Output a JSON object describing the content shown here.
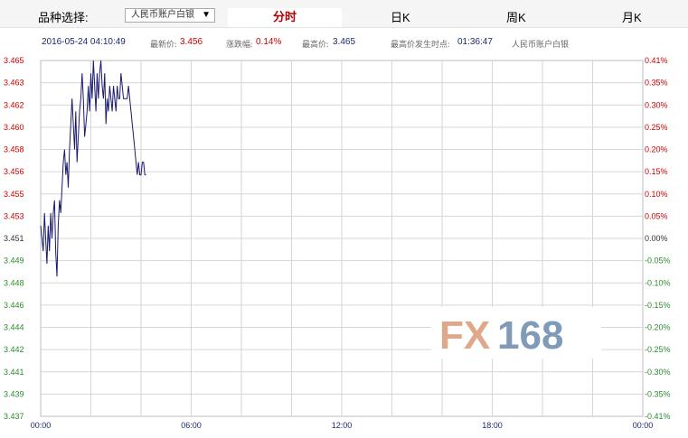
{
  "header": {
    "selector_label": "品种选择:",
    "selector_value": "人民币账户白银",
    "selector_arrow": "▼",
    "tabs": [
      {
        "label": "分时",
        "active": true
      },
      {
        "label": "日K",
        "active": false
      },
      {
        "label": "周K",
        "active": false
      },
      {
        "label": "月K",
        "active": false
      }
    ]
  },
  "info_bar": {
    "datetime": "2016-05-24 04:10:49",
    "latest_label": "最新价:",
    "latest_value": "3.456",
    "change_label": "涨跌幅:",
    "change_value": "0.14%",
    "high_label": "最高价:",
    "high_value": "3.465",
    "high_time_label": "最高价发生时点:",
    "high_time_value": "01:36:47",
    "product_name": "人民币账户白银"
  },
  "watermark": {
    "prefix": "FX",
    "suffix": "168"
  },
  "colors": {
    "line": "#1a1a6e",
    "up": "#cc0000",
    "down": "#2e8b2e",
    "neutral": "#333333",
    "watermark_fx": "#e0a88a",
    "watermark_num": "#7f9bb8"
  },
  "chart_data": {
    "type": "line",
    "x_ticks": [
      "00:00",
      "06:00",
      "12:00",
      "18:00",
      "00:00"
    ],
    "x_range_hours": [
      0,
      24
    ],
    "ylim": [
      3.437,
      3.465
    ],
    "y_ticks_left": [
      "3.465",
      "3.463",
      "3.462",
      "3.460",
      "3.458",
      "3.456",
      "3.455",
      "3.453",
      "3.451",
      "3.449",
      "3.448",
      "3.446",
      "3.444",
      "3.442",
      "3.441",
      "3.439",
      "3.437"
    ],
    "y_ticks_right": [
      "0.41%",
      "0.35%",
      "0.30%",
      "0.25%",
      "0.20%",
      "0.15%",
      "0.10%",
      "0.05%",
      "0.00%",
      "-0.05%",
      "-0.10%",
      "-0.15%",
      "-0.20%",
      "-0.25%",
      "-0.30%",
      "-0.35%",
      "-0.41%"
    ],
    "grid": true,
    "series": [
      {
        "hours": [
          0.0,
          0.05,
          0.1,
          0.15,
          0.2,
          0.25,
          0.3,
          0.35,
          0.4,
          0.45,
          0.5,
          0.55,
          0.6,
          0.65,
          0.7,
          0.75,
          0.8,
          0.85,
          0.9,
          0.95,
          1.0,
          1.05,
          1.1,
          1.15,
          1.2,
          1.25,
          1.3,
          1.35,
          1.4,
          1.45,
          1.5,
          1.55,
          1.6,
          1.65,
          1.7,
          1.75,
          1.8,
          1.85,
          1.9,
          1.95,
          2.0,
          2.05,
          2.1,
          2.15,
          2.2,
          2.25,
          2.3,
          2.35,
          2.4,
          2.45,
          2.5,
          2.55,
          2.6,
          2.65,
          2.7,
          2.75,
          2.8,
          2.85,
          2.9,
          2.95,
          3.0,
          3.05,
          3.1,
          3.15,
          3.2,
          3.25,
          3.3,
          3.35,
          3.4,
          3.45,
          3.5,
          3.55,
          3.6,
          3.65,
          3.7,
          3.75,
          3.8,
          3.85,
          3.9,
          3.95,
          4.0,
          4.05,
          4.1,
          4.15,
          4.2
        ],
        "values": [
          3.452,
          3.451,
          3.45,
          3.453,
          3.451,
          3.449,
          3.452,
          3.45,
          3.453,
          3.451,
          3.453,
          3.454,
          3.45,
          3.448,
          3.452,
          3.454,
          3.453,
          3.455,
          3.457,
          3.458,
          3.456,
          3.457,
          3.455,
          3.458,
          3.46,
          3.462,
          3.46,
          3.458,
          3.461,
          3.457,
          3.459,
          3.461,
          3.462,
          3.464,
          3.462,
          3.459,
          3.46,
          3.461,
          3.463,
          3.461,
          3.464,
          3.462,
          3.465,
          3.463,
          3.461,
          3.464,
          3.462,
          3.464,
          3.465,
          3.463,
          3.462,
          3.464,
          3.46,
          3.462,
          3.461,
          3.463,
          3.462,
          3.461,
          3.463,
          3.462,
          3.461,
          3.463,
          3.462,
          3.462,
          3.464,
          3.463,
          3.462,
          3.462,
          3.462,
          3.462,
          3.463,
          3.462,
          3.461,
          3.46,
          3.459,
          3.458,
          3.457,
          3.456,
          3.457,
          3.456,
          3.456,
          3.457,
          3.457,
          3.456,
          3.456
        ]
      }
    ]
  }
}
